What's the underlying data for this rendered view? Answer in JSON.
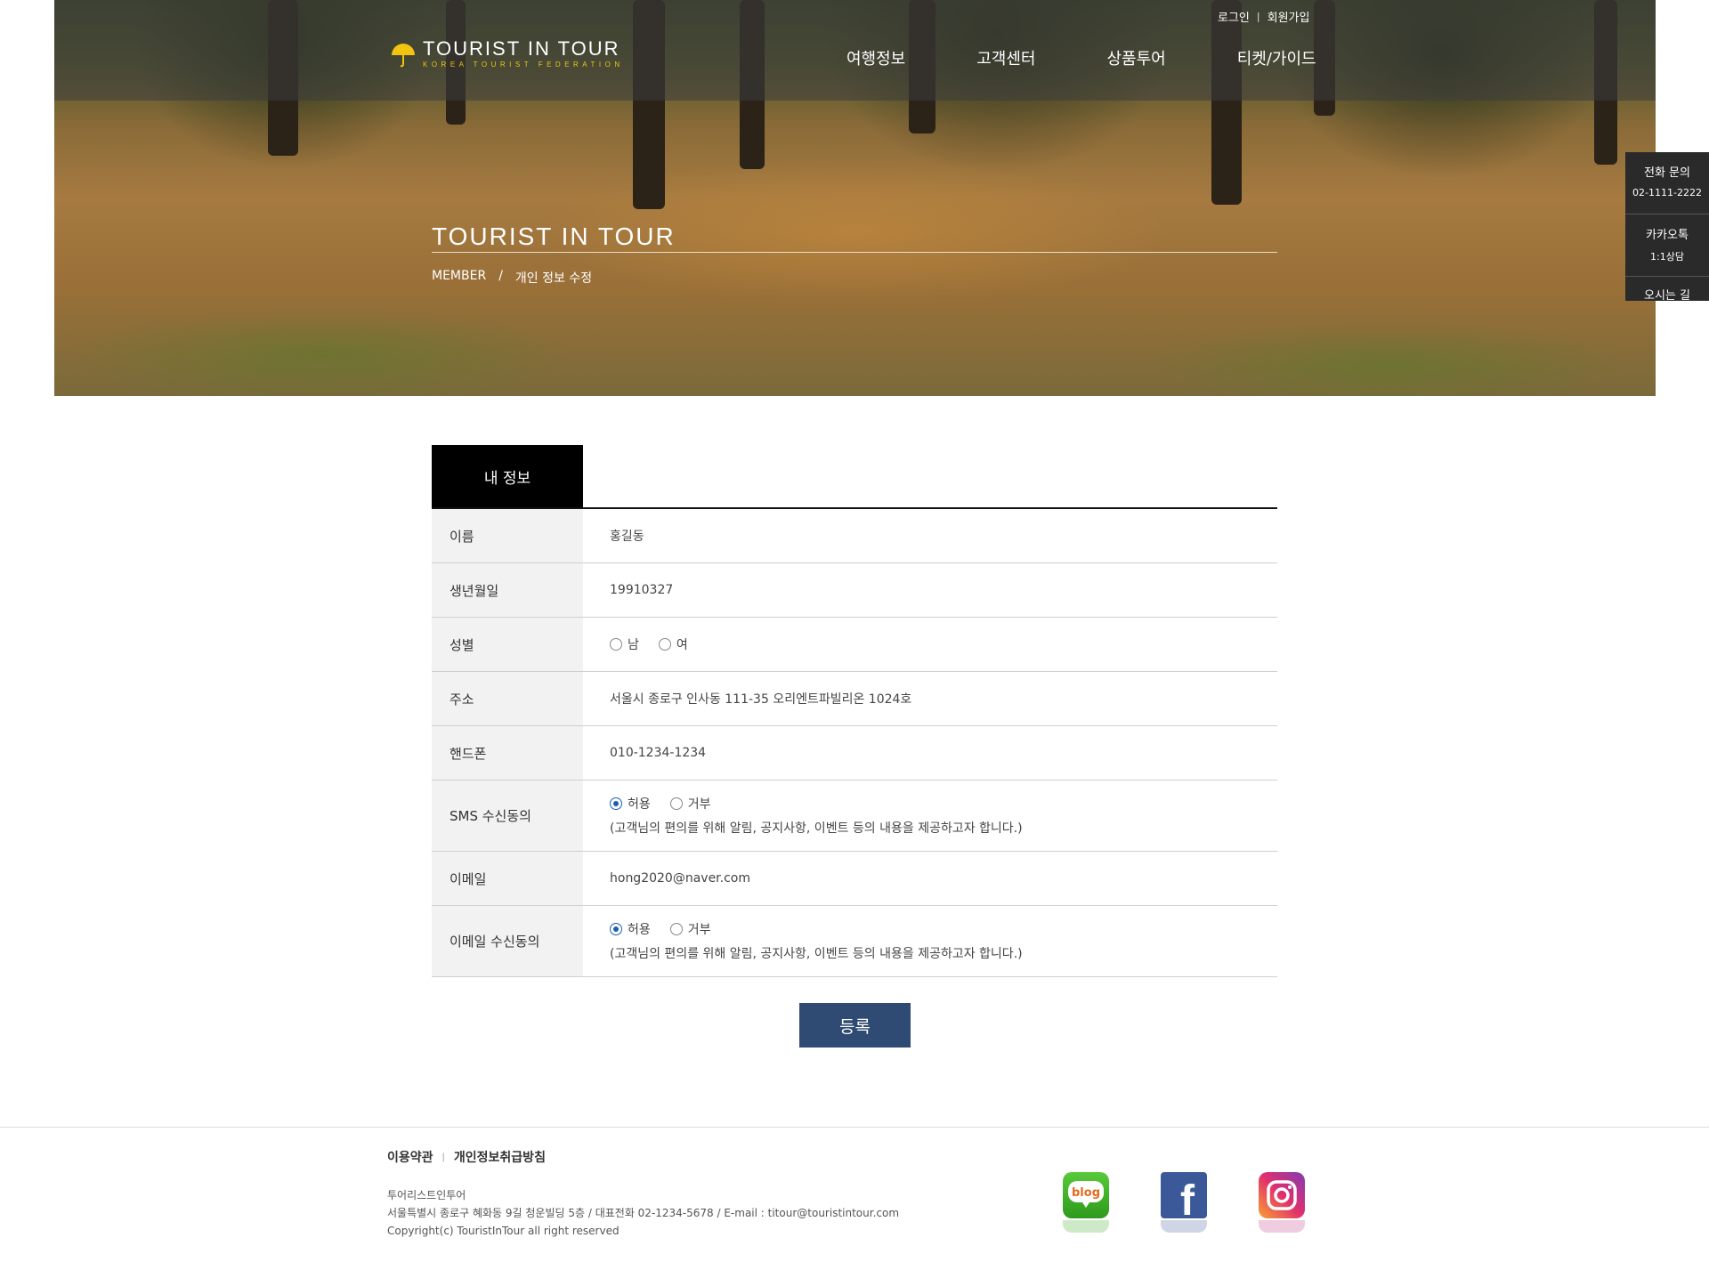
{
  "header": {
    "logo_text": "TOURIST IN TOUR",
    "logo_sub": "KOREA TOURIST FEDERATION",
    "util_links": {
      "login": "로그인",
      "separator": "|",
      "join": "회원가입"
    },
    "nav": [
      "여행정보",
      "고객센터",
      "상품투어",
      "티켓/가이드"
    ]
  },
  "hero": {
    "title": "TOURIST IN TOUR",
    "breadcrumb": {
      "first": "MEMBER",
      "sep": "/",
      "current": "개인 정보 수정"
    }
  },
  "quick_menu": {
    "phone_label": "전화 문의",
    "phone_number": "02-1111-2222",
    "kakao_label": "카카오톡",
    "kakao_sub": "1:1상담",
    "third_label": "오시는 길"
  },
  "tab": {
    "label": "내 정보"
  },
  "form": {
    "name": {
      "label": "이름",
      "value": "홍길동"
    },
    "birth": {
      "label": "생년월일",
      "value": "19910327"
    },
    "gender": {
      "label": "성별",
      "options": [
        "남",
        "여"
      ],
      "selected": ""
    },
    "address": {
      "label": "주소",
      "value": "서울시 종로구 인사동 111-35 오리엔트파빌리온 1024호"
    },
    "phone": {
      "label": "핸드폰",
      "value": "010-1234-1234"
    },
    "sms_consent": {
      "label": "SMS 수신동의",
      "options": [
        "허용",
        "거부"
      ],
      "selected": "허용",
      "note": "(고객님의 편의를 위해 알림, 공지사항, 이벤트 등의 내용을 제공하고자 합니다.)"
    },
    "email": {
      "label": "이메일",
      "value": "hong2020@naver.com"
    },
    "email_consent": {
      "label": "이메일 수신동의",
      "options": [
        "허용",
        "거부"
      ],
      "selected": "허용",
      "note": "(고객님의 편의를 위해 알림, 공지사항, 이벤트 등의 내용을 제공하고자 합니다.)"
    },
    "submit_label": "등록"
  },
  "footer": {
    "links": {
      "terms": "이용약관",
      "separator": "|",
      "privacy": "개인정보취급방침"
    },
    "company": "투어리스트인투어",
    "address_line": "서울특별시 종로구 혜화동 9길 청운빌딩 5층 / 대표전화 02-1234-5678 / E-mail : titour@touristintour.com",
    "copyright": "Copyright(c) TouristInTour all right reserved",
    "sns": {
      "blog": "blog",
      "facebook": "f"
    }
  },
  "colors": {
    "submit_bg": "#2f4a73",
    "tab_bg": "#000000",
    "accent_yellow": "#f1c40f",
    "radio_on": "#1a5fb4"
  }
}
